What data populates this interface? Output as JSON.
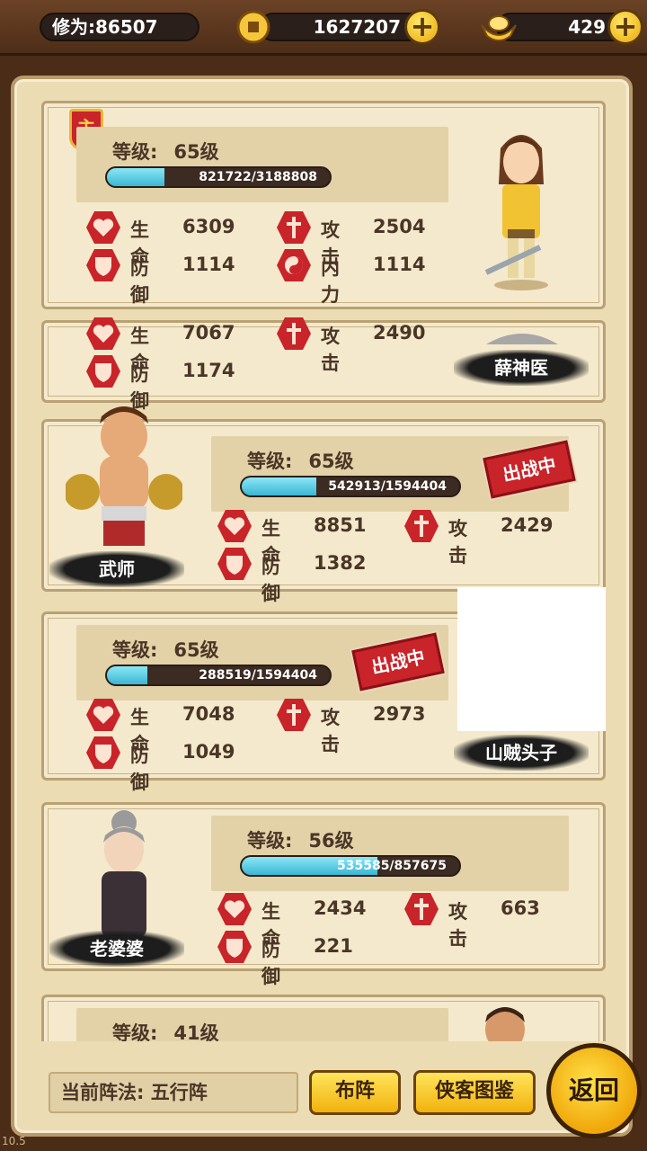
{
  "topbar": {
    "xiuwei": "修为:86507",
    "coins": "1627207",
    "gold": "429"
  },
  "heroes": [
    {
      "level_label": "等级:",
      "level": "65级",
      "xp": "821722/3188808",
      "xp_ratio": 0.258,
      "stats": {
        "hp_label": "生命",
        "hp": "6309",
        "atk_label": "攻击",
        "atk": "2504",
        "def_label": "防御",
        "def": "1114",
        "neili_label": "内力",
        "neili": "1114"
      },
      "master_badge": "主"
    },
    {
      "name": "薛神医",
      "stats": {
        "hp_label": "生命",
        "hp": "7067",
        "atk_label": "攻击",
        "atk": "2490",
        "def_label": "防御",
        "def": "1174"
      }
    },
    {
      "name": "武师",
      "level_label": "等级:",
      "level": "65级",
      "xp": "542913/1594404",
      "xp_ratio": 0.341,
      "in_battle": "出战中",
      "stats": {
        "hp_label": "生命",
        "hp": "8851",
        "atk_label": "攻击",
        "atk": "2429",
        "def_label": "防御",
        "def": "1382"
      }
    },
    {
      "name": "山贼头子",
      "level_label": "等级:",
      "level": "65级",
      "xp": "288519/1594404",
      "xp_ratio": 0.181,
      "in_battle": "出战中",
      "stats": {
        "hp_label": "生命",
        "hp": "7048",
        "atk_label": "攻击",
        "atk": "2973",
        "def_label": "防御",
        "def": "1049"
      }
    },
    {
      "name": "老婆婆",
      "level_label": "等级:",
      "level": "56级",
      "xp": "535585/857675",
      "xp_ratio": 0.624,
      "stats": {
        "hp_label": "生命",
        "hp": "2434",
        "atk_label": "攻击",
        "atk": "663",
        "def_label": "防御",
        "def": "221"
      }
    },
    {
      "level_label": "等级:",
      "level": "41级"
    }
  ],
  "bottom": {
    "formation": "当前阵法: 五行阵",
    "buzhen": "布阵",
    "tujian": "侠客图鉴",
    "back": "返回"
  },
  "version": "10.5",
  "colors": {
    "hp": "#c8242a",
    "atk": "#c8242a",
    "xp": "#3bb6d3",
    "button": "#f2b20c"
  }
}
